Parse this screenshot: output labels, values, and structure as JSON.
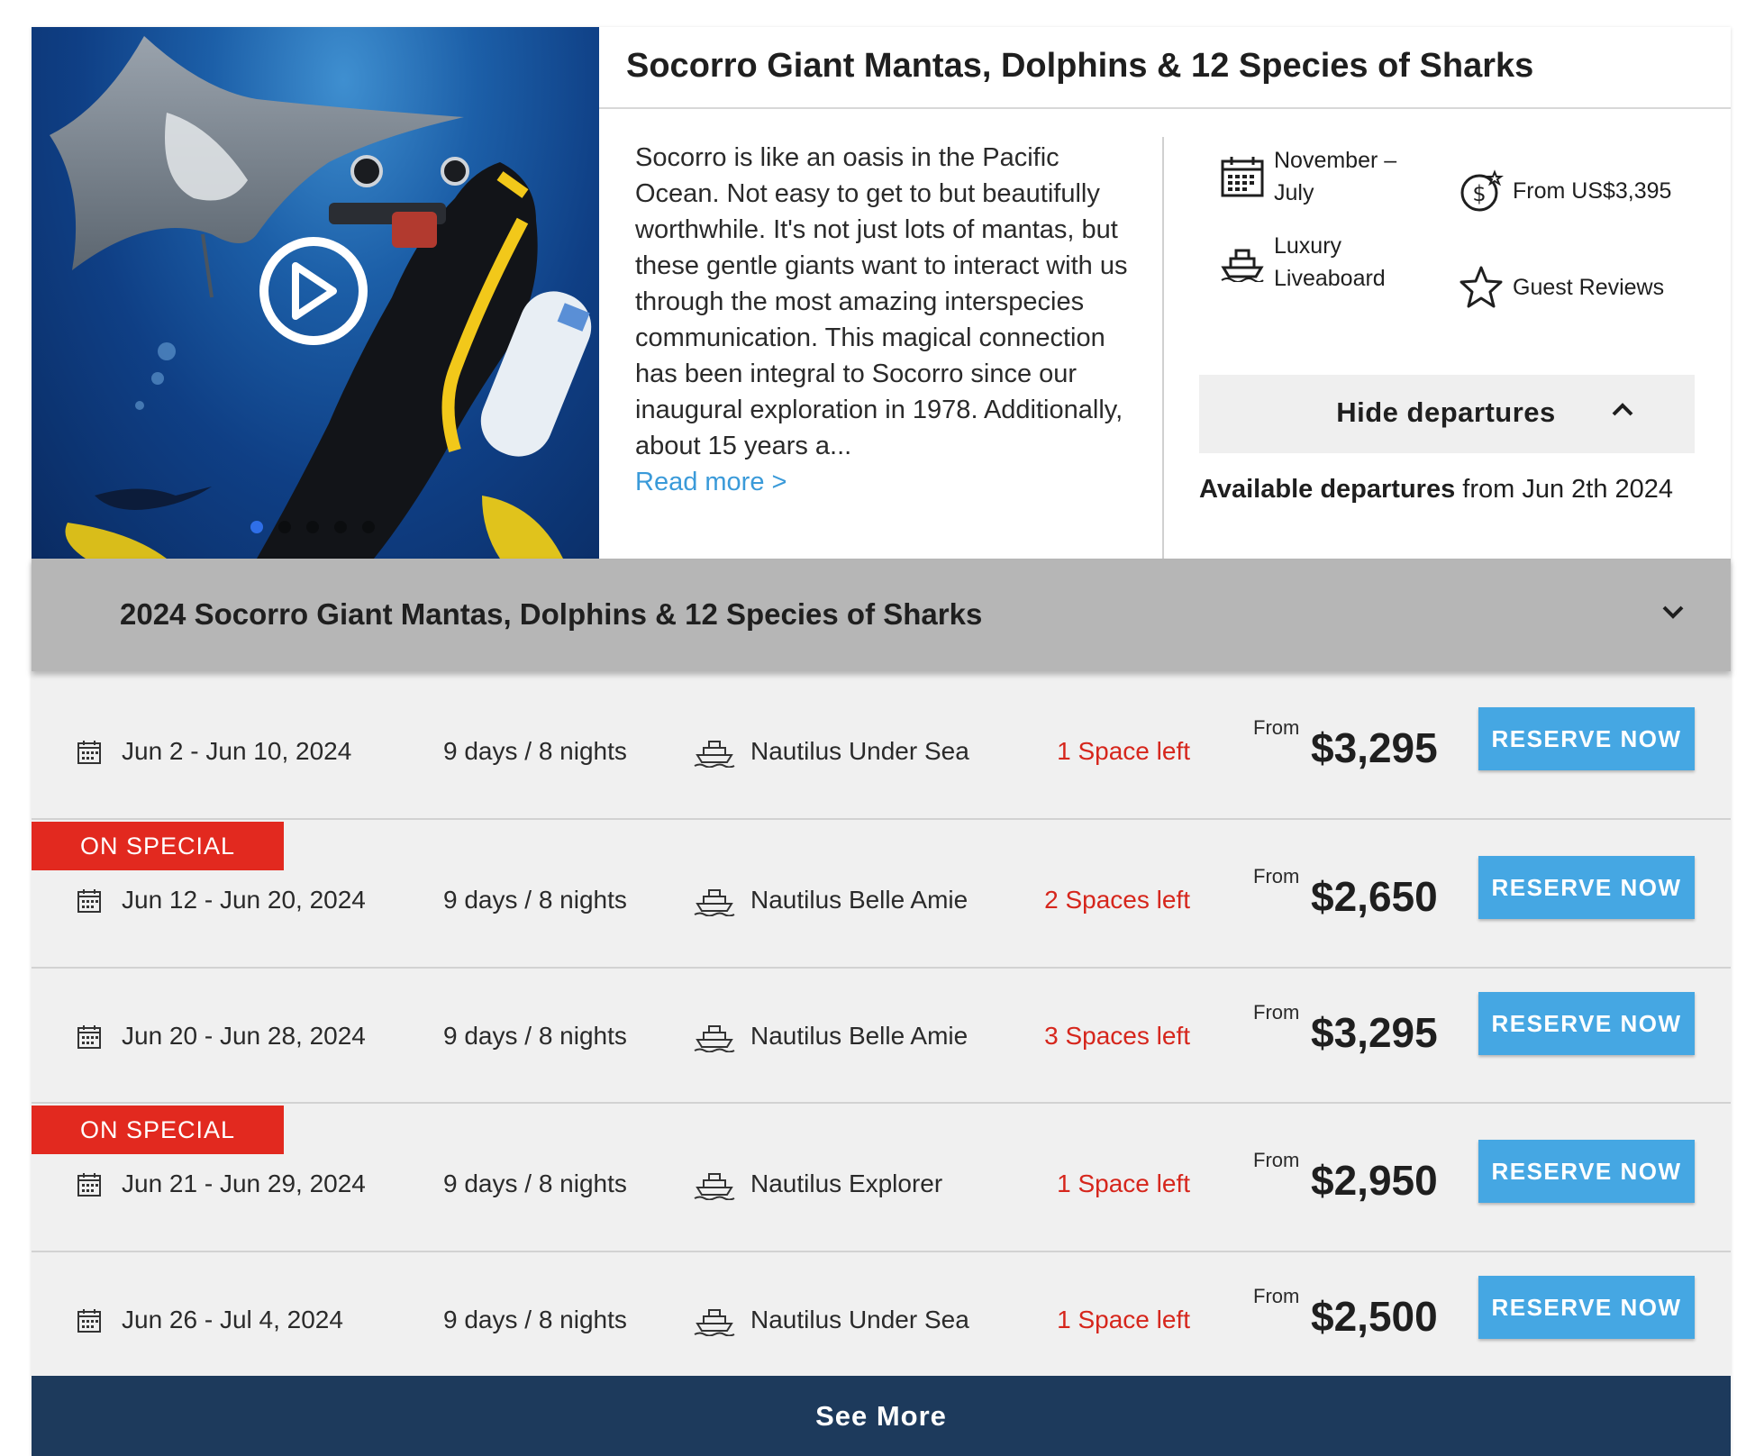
{
  "trip": {
    "title": "Socorro Giant Mantas, Dolphins & 12 Species of Sharks",
    "description": "Socorro is like an oasis in the Pacific Ocean. Not easy to get to but beautifully worthwhile. It's not just lots of mantas, but these gentle giants want to interact with us through the most amazing interspecies communication. This magical connection has been integral to Socorro since our inaugural exploration in 1978. Additionally, about 15 years a...",
    "read_more": "Read more >"
  },
  "features": {
    "season": "November – July",
    "price": "From US$3,395",
    "vessel": "Luxury Liveaboard",
    "reviews": "Guest Reviews"
  },
  "departures": {
    "toggle_label": "Hide departures",
    "available_bold": "Available departures",
    "available_rest": " from Jun 2th 2024",
    "year_title": "2024 Socorro Giant Mantas, Dolphins & 12 Species of Sharks",
    "from_label": "From",
    "reserve_label": "RESERVE NOW",
    "special_label": "ON SPECIAL",
    "rows": [
      {
        "date": "Jun 2 - Jun 10, 2024",
        "duration": "9 days / 8 nights",
        "ship": "Nautilus Under Sea",
        "spaces": "1 Space left",
        "price": "$3,295",
        "special": false
      },
      {
        "date": "Jun 12 - Jun 20, 2024",
        "duration": "9 days / 8 nights",
        "ship": "Nautilus Belle Amie",
        "spaces": "2 Spaces left",
        "price": "$2,650",
        "special": true
      },
      {
        "date": "Jun 20 - Jun 28, 2024",
        "duration": "9 days / 8 nights",
        "ship": "Nautilus Belle Amie",
        "spaces": "3 Spaces left",
        "price": "$3,295",
        "special": false
      },
      {
        "date": "Jun 21 - Jun 29, 2024",
        "duration": "9 days / 8 nights",
        "ship": "Nautilus Explorer",
        "spaces": "1 Space left",
        "price": "$2,950",
        "special": true
      },
      {
        "date": "Jun 26 - Jul 4, 2024",
        "duration": "9 days / 8 nights",
        "ship": "Nautilus Under Sea",
        "spaces": "1 Space left",
        "price": "$2,500",
        "special": false
      }
    ],
    "see_more": "See More"
  },
  "carousel": {
    "slide_count": 5,
    "active_index": 0
  },
  "colors": {
    "special": "#e2291f",
    "reserve": "#45a7e3",
    "spaces": "#d6261c",
    "link": "#3a9ad9",
    "see_more_bg": "#1d3a5c",
    "year_bar_bg": "#b6b6b6"
  },
  "icons": {
    "season": "calendar-icon",
    "price": "dollar-coin-icon",
    "vessel": "ship-icon",
    "reviews": "star-icon",
    "play": "play-icon",
    "toggle": "chevron-up-icon",
    "year_toggle": "chevron-down-icon"
  }
}
